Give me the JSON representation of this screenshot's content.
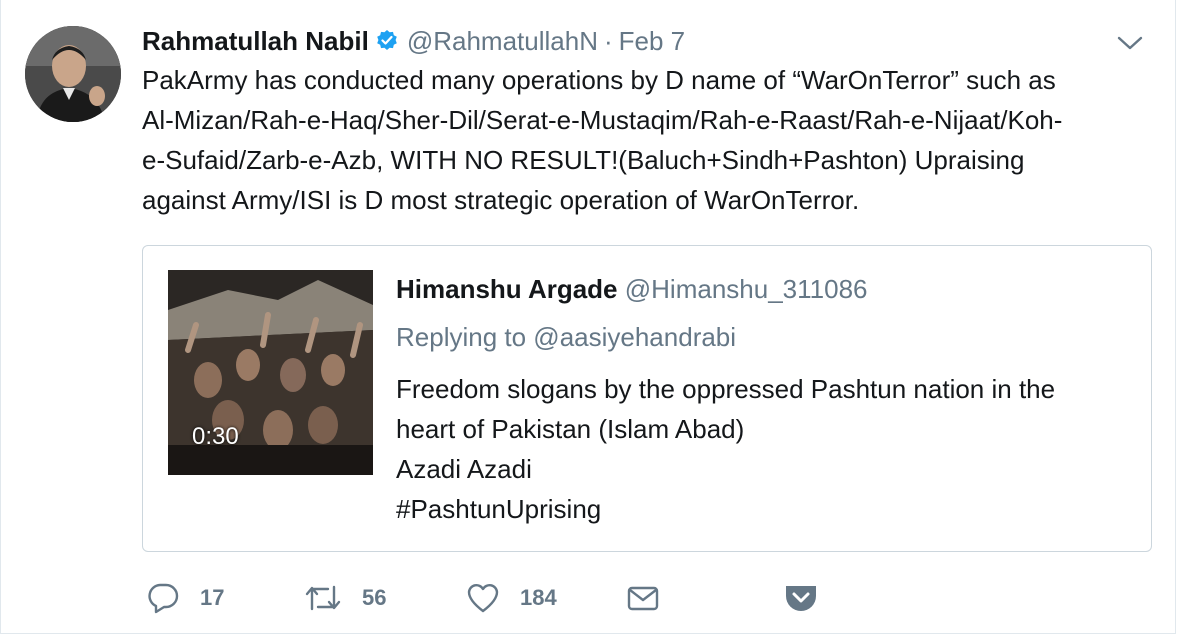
{
  "tweet": {
    "author_name": "Rahmatullah Nabil",
    "author_handle": "@RahmatullahN",
    "separator": "·",
    "date": "Feb 7",
    "text_lines": [
      "PakArmy has conducted many operations by D name of “WarOnTerror” such as",
      "Al-Mizan/Rah-e-Haq/Sher-Dil/Serat-e-Mustaqim/Rah-e-Raast/Rah-e-Nijaat/Koh-",
      "e-Sufaid/Zarb-e-Azb, WITH NO RESULT!(Baluch+Sindh+Pashton) Upraising",
      "against Army/ISI is D most strategic operation of WarOnTerror."
    ]
  },
  "quoted": {
    "author_name": "Himanshu Argade",
    "author_handle": "@Himanshu_311086",
    "replying_to": "Replying to @aasiyehandrabi",
    "text_lines": [
      "Freedom slogans by the oppressed Pashtun nation in the",
      "heart of Pakistan (Islam Abad)",
      "Azadi Azadi",
      "#PashtunUprising"
    ],
    "video_duration": "0:30"
  },
  "actions": {
    "reply_count": "17",
    "retweet_count": "56",
    "like_count": "184"
  },
  "colors": {
    "text": "#14171a",
    "secondary": "#657786",
    "verified": "#1da1f2",
    "border": "#ccd6dd"
  },
  "icons": [
    "verified-badge-icon",
    "caret-down-icon",
    "reply-icon",
    "retweet-icon",
    "like-icon",
    "direct-message-icon",
    "pocket-icon"
  ]
}
